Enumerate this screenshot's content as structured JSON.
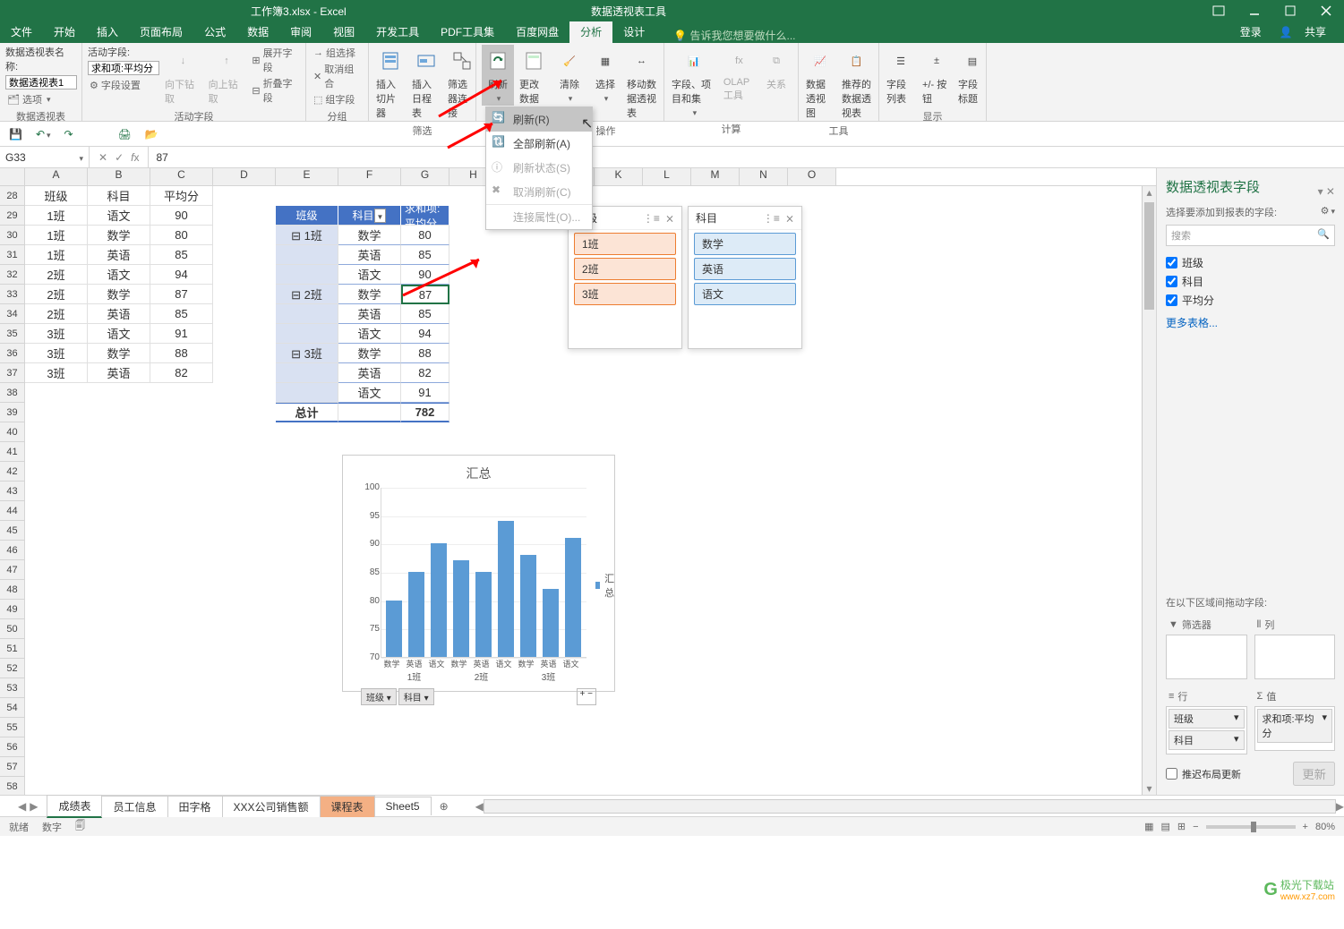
{
  "title_bar": {
    "file": "工作簿3.xlsx - Excel",
    "tool": "数据透视表工具"
  },
  "tabs": [
    "文件",
    "开始",
    "插入",
    "页面布局",
    "公式",
    "数据",
    "审阅",
    "视图",
    "开发工具",
    "PDF工具集",
    "百度网盘",
    "分析",
    "设计"
  ],
  "active_tab": "分析",
  "tell_me": "告诉我您想要做什么...",
  "login": "登录",
  "share": "共享",
  "ribbon": {
    "grp1": {
      "name_label": "数据透视表名称:",
      "name_value": "数据透视表1",
      "options": "选项",
      "label": "数据透视表"
    },
    "grp2": {
      "active_label": "活动字段:",
      "active_value": "求和项:平均分",
      "settings": "字段设置",
      "drill_down": "向下钻取",
      "drill_up": "向上钻取",
      "expand": "展开字段",
      "collapse": "折叠字段",
      "label": "活动字段"
    },
    "grp3": {
      "sel": "组选择",
      "cancel": "取消组合",
      "field": "组字段",
      "label": "分组"
    },
    "grp4": {
      "slicer": "插入切片器",
      "timeline": "插入日程表",
      "conn": "筛选器连接",
      "label": "筛选"
    },
    "grp5": {
      "refresh": "刷新",
      "change": "更改数据源"
    },
    "grp6": {
      "clear": "清除",
      "select": "选择",
      "move": "移动数据透视表",
      "label": "操作"
    },
    "grp7": {
      "fields": "字段、项目和集",
      "olap": "OLAP 工具",
      "rel": "关系",
      "label": "计算"
    },
    "grp8": {
      "chart": "数据透视图",
      "rec": "推荐的数据透视表",
      "label": "工具"
    },
    "grp9": {
      "list": "字段列表",
      "btns": "+/- 按钮",
      "headers": "字段标题",
      "label": "显示"
    }
  },
  "refresh_menu": {
    "refresh": "刷新(R)",
    "refresh_all": "全部刷新(A)",
    "status": "刷新状态(S)",
    "cancel": "取消刷新(C)",
    "conn": "连接属性(O)..."
  },
  "name_box": "G33",
  "formula_value": "87",
  "col_headers": [
    "A",
    "B",
    "C",
    "D",
    "E",
    "F",
    "G",
    "H",
    "I",
    "J",
    "K",
    "L",
    "M",
    "N",
    "O"
  ],
  "row_start": 28,
  "row_count": 32,
  "data_left": {
    "headers": [
      "班级",
      "科目",
      "平均分"
    ],
    "rows": [
      [
        "1班",
        "语文",
        "90"
      ],
      [
        "1班",
        "数学",
        "80"
      ],
      [
        "1班",
        "英语",
        "85"
      ],
      [
        "2班",
        "语文",
        "94"
      ],
      [
        "2班",
        "数学",
        "87"
      ],
      [
        "2班",
        "英语",
        "85"
      ],
      [
        "3班",
        "语文",
        "91"
      ],
      [
        "3班",
        "数学",
        "88"
      ],
      [
        "3班",
        "英语",
        "82"
      ]
    ]
  },
  "pivot": {
    "h1": "班级",
    "h2": "科目",
    "h3": "求和项:平均分",
    "groups": [
      {
        "name": "1班",
        "rows": [
          [
            "数学",
            "80"
          ],
          [
            "英语",
            "85"
          ],
          [
            "语文",
            "90"
          ]
        ]
      },
      {
        "name": "2班",
        "rows": [
          [
            "数学",
            "87"
          ],
          [
            "英语",
            "85"
          ],
          [
            "语文",
            "94"
          ]
        ]
      },
      {
        "name": "3班",
        "rows": [
          [
            "数学",
            "88"
          ],
          [
            "英语",
            "82"
          ],
          [
            "语文",
            "91"
          ]
        ]
      }
    ],
    "total_label": "总计",
    "total_value": "782"
  },
  "slicer1": {
    "title": "班级",
    "items": [
      "1班",
      "2班",
      "3班"
    ]
  },
  "slicer2": {
    "title": "科目",
    "items": [
      "数学",
      "英语",
      "语文"
    ]
  },
  "chart_data": {
    "type": "bar",
    "title": "汇总",
    "categories": [
      "数学",
      "英语",
      "语文",
      "数学",
      "英语",
      "语文",
      "数学",
      "英语",
      "语文"
    ],
    "groups": [
      "1班",
      "2班",
      "3班"
    ],
    "values": [
      80,
      85,
      90,
      87,
      85,
      94,
      88,
      82,
      91
    ],
    "ylim": [
      70,
      100
    ],
    "yticks": [
      70,
      75,
      80,
      85,
      90,
      95,
      100
    ],
    "legend": "汇总",
    "filters": [
      "班级",
      "科目"
    ]
  },
  "field_pane": {
    "title": "数据透视表字段",
    "sub": "选择要添加到报表的字段:",
    "search": "搜索",
    "fields": [
      "班级",
      "科目",
      "平均分"
    ],
    "more": "更多表格...",
    "drag_label": "在以下区域间拖动字段:",
    "areas": {
      "filter": "筛选器",
      "col": "列",
      "row": "行",
      "val": "值"
    },
    "row_items": [
      "班级",
      "科目"
    ],
    "val_items": [
      "求和项:平均分"
    ],
    "defer": "推迟布局更新",
    "update": "更新"
  },
  "sheet_tabs": [
    "成绩表",
    "员工信息",
    "田字格",
    "XXX公司销售额",
    "课程表",
    "Sheet5"
  ],
  "status": {
    "ready": "就绪",
    "mode": "数字",
    "zoom": "80%"
  },
  "watermark": {
    "name": "极光下载站",
    "url": "www.xz7.com"
  }
}
